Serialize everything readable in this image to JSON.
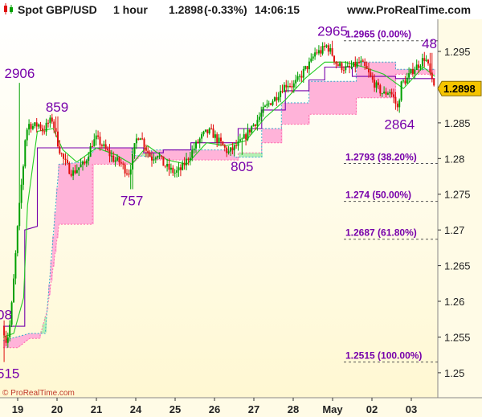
{
  "header": {
    "title": "Spot GBP/USD",
    "timeframe": "1 hour",
    "price": "1.2898",
    "change": "(-0.33%)",
    "time": "14:06:15",
    "site": "www.ProRealTime.com"
  },
  "copyright": "© ProRealTime.com",
  "colors": {
    "bull": "#00a000",
    "bear": "#e01010",
    "base_line": "#7700aa",
    "conversion_line": "#22cc22",
    "cloud_bull": "#ffb3d9",
    "cloud_bear": "#b3f0b3",
    "fib_text": "#7700aa",
    "price_badge": "#f5c400",
    "background_top": "#ffffff",
    "background_bottom": "#fff9d6"
  },
  "chart_data": {
    "type": "candlestick",
    "title": "Spot GBP/USD 1 hour",
    "ylim": [
      1.2465,
      1.2995
    ],
    "yticks": [
      "1.295",
      "1.29",
      "1.285",
      "1.28",
      "1.275",
      "1.27",
      "1.265",
      "1.26",
      "1.255",
      "1.25"
    ],
    "xticks": [
      {
        "label": "19",
        "x": 0
      },
      {
        "label": "20",
        "x": 1
      },
      {
        "label": "21",
        "x": 2
      },
      {
        "label": "24",
        "x": 3
      },
      {
        "label": "25",
        "x": 4
      },
      {
        "label": "26",
        "x": 5
      },
      {
        "label": "27",
        "x": 6
      },
      {
        "label": "28",
        "x": 7
      },
      {
        "label": "May",
        "x": 8
      },
      {
        "label": "02",
        "x": 9
      },
      {
        "label": "03",
        "x": 10
      }
    ],
    "xlim": [
      -0.37,
      10.6
    ],
    "current_price": "1.2898",
    "price_path": [
      [
        -0.37,
        1.2565
      ],
      [
        -0.3,
        1.2545
      ],
      [
        -0.22,
        1.2555
      ],
      [
        -0.15,
        1.2595
      ],
      [
        -0.08,
        1.2645
      ],
      [
        0.0,
        1.2705
      ],
      [
        0.08,
        1.2755
      ],
      [
        0.15,
        1.2795
      ],
      [
        0.2,
        1.2835
      ],
      [
        0.28,
        1.2848
      ],
      [
        0.4,
        1.2845
      ],
      [
        0.55,
        1.2848
      ],
      [
        0.65,
        1.2838
      ],
      [
        0.75,
        1.2848
      ],
      [
        0.88,
        1.2855
      ],
      [
        0.95,
        1.2838
      ],
      [
        1.05,
        1.2815
      ],
      [
        1.15,
        1.28
      ],
      [
        1.3,
        1.2785
      ],
      [
        1.4,
        1.278
      ],
      [
        1.5,
        1.2785
      ],
      [
        1.6,
        1.279
      ],
      [
        1.7,
        1.2792
      ],
      [
        1.8,
        1.2808
      ],
      [
        1.9,
        1.2822
      ],
      [
        2.0,
        1.2828
      ],
      [
        2.15,
        1.2818
      ],
      [
        2.3,
        1.2808
      ],
      [
        2.45,
        1.2798
      ],
      [
        2.6,
        1.2795
      ],
      [
        2.72,
        1.2785
      ],
      [
        2.82,
        1.278
      ],
      [
        2.9,
        1.2795
      ],
      [
        3.0,
        1.2825
      ],
      [
        3.1,
        1.2835
      ],
      [
        3.25,
        1.2815
      ],
      [
        3.4,
        1.28
      ],
      [
        3.55,
        1.2808
      ],
      [
        3.7,
        1.2792
      ],
      [
        3.85,
        1.2785
      ],
      [
        4.0,
        1.278
      ],
      [
        4.15,
        1.2785
      ],
      [
        4.3,
        1.2798
      ],
      [
        4.45,
        1.2812
      ],
      [
        4.6,
        1.2825
      ],
      [
        4.75,
        1.2835
      ],
      [
        4.9,
        1.2838
      ],
      [
        5.05,
        1.2828
      ],
      [
        5.2,
        1.2818
      ],
      [
        5.35,
        1.2808
      ],
      [
        5.5,
        1.2815
      ],
      [
        5.65,
        1.2822
      ],
      [
        5.8,
        1.2832
      ],
      [
        5.95,
        1.2845
      ],
      [
        6.1,
        1.2855
      ],
      [
        6.25,
        1.2868
      ],
      [
        6.4,
        1.2878
      ],
      [
        6.55,
        1.2885
      ],
      [
        6.7,
        1.2898
      ],
      [
        6.85,
        1.2905
      ],
      [
        7.0,
        1.2902
      ],
      [
        7.15,
        1.2912
      ],
      [
        7.3,
        1.2925
      ],
      [
        7.45,
        1.2935
      ],
      [
        7.55,
        1.2948
      ],
      [
        7.7,
        1.295
      ],
      [
        7.85,
        1.2958
      ],
      [
        8.0,
        1.2945
      ],
      [
        8.1,
        1.2932
      ],
      [
        8.25,
        1.2928
      ],
      [
        8.4,
        1.2925
      ],
      [
        8.55,
        1.293
      ],
      [
        8.7,
        1.2935
      ],
      [
        8.85,
        1.2925
      ],
      [
        9.0,
        1.291
      ],
      [
        9.15,
        1.2898
      ],
      [
        9.3,
        1.289
      ],
      [
        9.45,
        1.2895
      ],
      [
        9.55,
        1.2885
      ],
      [
        9.65,
        1.287
      ],
      [
        9.75,
        1.2905
      ],
      [
        9.9,
        1.2912
      ],
      [
        10.05,
        1.2925
      ],
      [
        10.2,
        1.2932
      ],
      [
        10.35,
        1.2942
      ],
      [
        10.45,
        1.2925
      ],
      [
        10.53,
        1.2905
      ],
      [
        10.6,
        1.2898
      ]
    ],
    "high_spikes": [
      [
        0.05,
        1.2906
      ],
      [
        8.0,
        1.2965
      ],
      [
        10.5,
        1.2948
      ],
      [
        1.0,
        1.2859
      ]
    ],
    "low_spikes": [
      [
        -0.35,
        1.2515
      ],
      [
        9.7,
        1.2864
      ],
      [
        2.9,
        1.2757
      ],
      [
        5.7,
        1.2805
      ]
    ],
    "base_line": [
      [
        -0.37,
        1.2565
      ],
      [
        0.18,
        1.2565
      ],
      [
        0.18,
        1.27
      ],
      [
        0.5,
        1.2705
      ],
      [
        0.5,
        1.2815
      ],
      [
        3.2,
        1.2815
      ],
      [
        3.2,
        1.2808
      ],
      [
        3.7,
        1.2808
      ],
      [
        3.7,
        1.2812
      ],
      [
        4.4,
        1.2812
      ],
      [
        4.4,
        1.2822
      ],
      [
        5.6,
        1.2822
      ],
      [
        5.6,
        1.2842
      ],
      [
        6.2,
        1.2842
      ],
      [
        6.2,
        1.2868
      ],
      [
        6.8,
        1.2868
      ],
      [
        6.8,
        1.2895
      ],
      [
        7.4,
        1.2895
      ],
      [
        7.4,
        1.291
      ],
      [
        7.8,
        1.291
      ],
      [
        7.8,
        1.2928
      ],
      [
        8.5,
        1.2928
      ],
      [
        8.5,
        1.2915
      ],
      [
        9.6,
        1.2915
      ],
      [
        9.6,
        1.2912
      ],
      [
        10.6,
        1.2912
      ]
    ],
    "conversion_line": [
      [
        -0.37,
        1.255
      ],
      [
        -0.1,
        1.2555
      ],
      [
        0.15,
        1.2605
      ],
      [
        0.25,
        1.2735
      ],
      [
        0.5,
        1.2838
      ],
      [
        0.9,
        1.2842
      ],
      [
        1.15,
        1.2812
      ],
      [
        1.5,
        1.2795
      ],
      [
        2.0,
        1.2815
      ],
      [
        2.5,
        1.2805
      ],
      [
        2.9,
        1.2792
      ],
      [
        3.3,
        1.2818
      ],
      [
        3.8,
        1.2798
      ],
      [
        4.3,
        1.2792
      ],
      [
        4.8,
        1.2822
      ],
      [
        5.3,
        1.2818
      ],
      [
        5.8,
        1.2825
      ],
      [
        6.3,
        1.2858
      ],
      [
        6.8,
        1.2882
      ],
      [
        7.3,
        1.2912
      ],
      [
        7.8,
        1.2935
      ],
      [
        8.3,
        1.2935
      ],
      [
        8.8,
        1.2928
      ],
      [
        9.3,
        1.2918
      ],
      [
        9.8,
        1.2898
      ],
      [
        10.3,
        1.2928
      ],
      [
        10.6,
        1.2915
      ]
    ],
    "span_a": [
      [
        -0.37,
        1.2535
      ],
      [
        0.0,
        1.2535
      ],
      [
        0.3,
        1.2548
      ],
      [
        0.55,
        1.2548
      ],
      [
        0.75,
        1.2588
      ],
      [
        1.05,
        1.2708
      ],
      [
        1.9,
        1.2708
      ],
      [
        1.9,
        1.2792
      ],
      [
        2.9,
        1.2792
      ],
      [
        3.2,
        1.2808
      ],
      [
        3.4,
        1.2808
      ],
      [
        3.4,
        1.2798
      ],
      [
        5.6,
        1.2798
      ],
      [
        5.6,
        1.2808
      ],
      [
        6.2,
        1.2808
      ],
      [
        6.2,
        1.2822
      ],
      [
        6.7,
        1.2822
      ],
      [
        6.7,
        1.2848
      ],
      [
        7.4,
        1.2848
      ],
      [
        7.4,
        1.2862
      ],
      [
        8.6,
        1.2862
      ],
      [
        8.6,
        1.2885
      ],
      [
        9.6,
        1.2885
      ],
      [
        9.6,
        1.2918
      ],
      [
        10.6,
        1.2918
      ]
    ],
    "span_b": [
      [
        -0.37,
        1.2545
      ],
      [
        0.3,
        1.2555
      ],
      [
        0.7,
        1.2555
      ],
      [
        1.05,
        1.2792
      ],
      [
        1.7,
        1.2795
      ],
      [
        2.0,
        1.2815
      ],
      [
        2.9,
        1.2815
      ],
      [
        2.9,
        1.2805
      ],
      [
        3.4,
        1.2802
      ],
      [
        3.4,
        1.2812
      ],
      [
        5.5,
        1.2812
      ],
      [
        5.5,
        1.2802
      ],
      [
        6.2,
        1.2802
      ],
      [
        6.2,
        1.2842
      ],
      [
        6.7,
        1.2842
      ],
      [
        6.7,
        1.2878
      ],
      [
        7.4,
        1.2878
      ],
      [
        7.4,
        1.2908
      ],
      [
        8.6,
        1.2908
      ],
      [
        8.6,
        1.2935
      ],
      [
        9.6,
        1.2935
      ],
      [
        9.6,
        1.2925
      ],
      [
        10.6,
        1.2925
      ]
    ],
    "fibonacci": [
      {
        "label": "1.2965 (0.00%)",
        "value": 1.2965
      },
      {
        "label": "1.2793 (38.20%)",
        "value": 1.2793
      },
      {
        "label": "1.274 (50.00%)",
        "value": 1.274
      },
      {
        "label": "1.2687 (61.80%)",
        "value": 1.2687
      },
      {
        "label": "1.2515 (100.00%)",
        "value": 1.2515
      }
    ],
    "annotations": [
      {
        "label": "2906",
        "x": 0.05,
        "y": 1.2906
      },
      {
        "label": "859",
        "x": 1.0,
        "y": 1.2859
      },
      {
        "label": "757",
        "x": 2.9,
        "y": 1.2757
      },
      {
        "label": "805",
        "x": 5.7,
        "y": 1.2805
      },
      {
        "label": "2965",
        "x": 8.0,
        "y": 1.2965
      },
      {
        "label": "48",
        "x": 10.5,
        "y": 1.2948
      },
      {
        "label": "2864",
        "x": 9.7,
        "y": 1.2864
      },
      {
        "label": "08",
        "x": -0.37,
        "y": 1.2568
      },
      {
        "label": "515",
        "x": -0.35,
        "y": 1.2515
      }
    ]
  }
}
